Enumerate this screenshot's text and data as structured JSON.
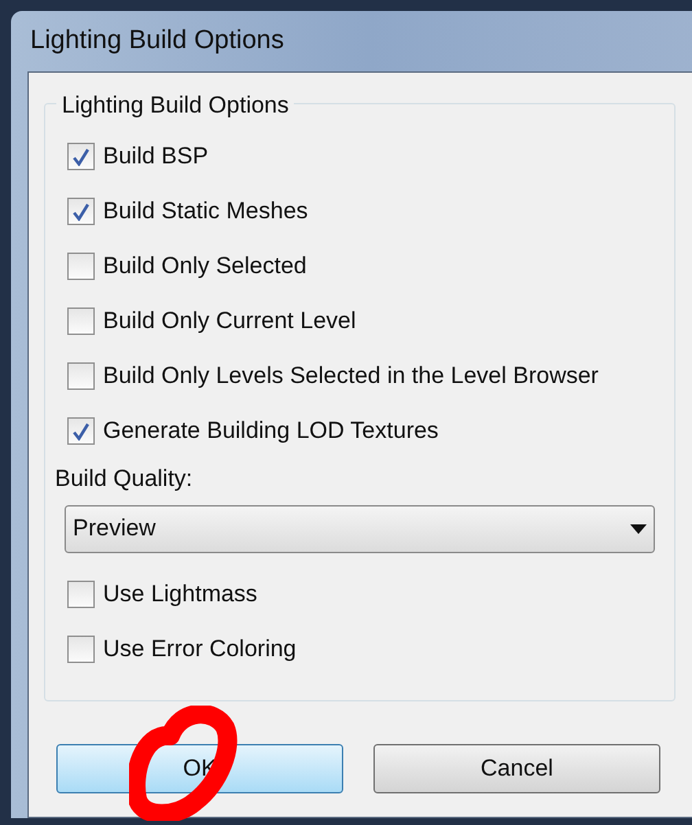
{
  "window": {
    "title": "Lighting Build Options"
  },
  "group": {
    "title": "Lighting Build Options",
    "options": [
      {
        "label": "Build BSP",
        "checked": true
      },
      {
        "label": "Build Static Meshes",
        "checked": true
      },
      {
        "label": "Build Only Selected",
        "checked": false
      },
      {
        "label": "Build Only Current Level",
        "checked": false
      },
      {
        "label": "Build Only Levels Selected in the Level Browser",
        "checked": false
      },
      {
        "label": "Generate Building LOD Textures",
        "checked": true
      }
    ],
    "quality_label": "Build Quality:",
    "quality_dropdown": {
      "value": "Preview"
    },
    "extra_options": [
      {
        "label": "Use Lightmass",
        "checked": false
      },
      {
        "label": "Use Error Coloring",
        "checked": false
      }
    ]
  },
  "buttons": [
    {
      "label": "OK",
      "default": true
    },
    {
      "label": "Cancel",
      "default": false
    }
  ]
}
